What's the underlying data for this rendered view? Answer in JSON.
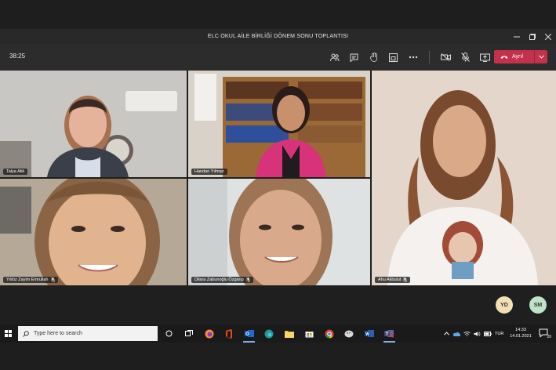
{
  "window": {
    "title": "ELC OKUL AİLE BİRLİĞİ DÖNEM SONU TOPLANTISI",
    "controls": [
      "minimize",
      "restore",
      "close"
    ]
  },
  "toolbar": {
    "timer": "38:25",
    "icons": [
      "participants-icon",
      "chat-icon",
      "raise-hand-icon",
      "rooms-icon",
      "more-icon",
      "camera-off-icon",
      "mic-off-icon",
      "share-icon"
    ],
    "leave_label": "Ayrıl",
    "leave_color": "#c4314b"
  },
  "participants": [
    {
      "name": "Talya Atik",
      "muted": false
    },
    {
      "name": "Handan Yılmaz",
      "muted": false
    },
    {
      "name": "Ahu Akbulut",
      "muted": true
    },
    {
      "name": "Yıldız Zayim Emrullah",
      "muted": true
    },
    {
      "name": "Dilara Zabunoğlu Özgarip",
      "muted": true
    }
  ],
  "avatars": [
    {
      "initials": "YD",
      "color": "#f3dfb3"
    },
    {
      "initials": "SM",
      "color": "#bfe3c7"
    }
  ],
  "taskbar": {
    "search_placeholder": "Type here to search",
    "apps": [
      "task-view-icon",
      "firefox-icon",
      "office-icon",
      "outlook-icon",
      "edge-icon",
      "file-explorer-icon",
      "store-icon",
      "chrome-icon",
      "paint-icon",
      "word-icon",
      "teams-icon"
    ],
    "active_app": "teams-icon",
    "language": "TUR",
    "time": "14:33",
    "date": "14.01.2021",
    "notification_count": "20"
  }
}
